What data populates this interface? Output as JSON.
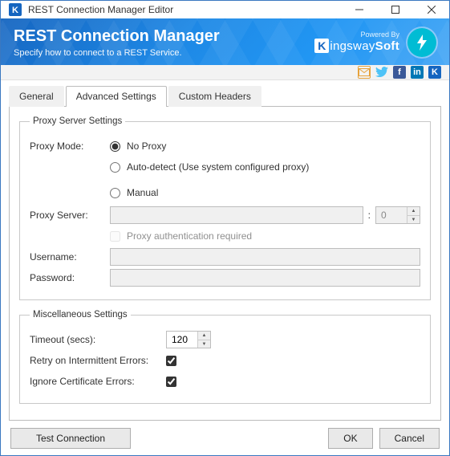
{
  "window": {
    "title": "REST Connection Manager Editor"
  },
  "banner": {
    "title": "REST Connection Manager",
    "subtitle": "Specify how to connect to a REST Service.",
    "powered_by": "Powered By",
    "brand_main": "ingsway",
    "brand_suffix": "Soft"
  },
  "tabs": {
    "general": "General",
    "advanced": "Advanced Settings",
    "custom": "Custom Headers"
  },
  "proxy": {
    "legend": "Proxy Server Settings",
    "mode_label": "Proxy Mode:",
    "opt_none": "No Proxy",
    "opt_auto": "Auto-detect (Use system configured proxy)",
    "opt_manual": "Manual",
    "server_label": "Proxy Server:",
    "server_value": "",
    "port_value": "0",
    "auth_label": "Proxy authentication required",
    "user_label": "Username:",
    "user_value": "",
    "pass_label": "Password:",
    "pass_value": ""
  },
  "misc": {
    "legend": "Miscellaneous Settings",
    "timeout_label": "Timeout (secs):",
    "timeout_value": "120",
    "retry_label": "Retry on Intermittent Errors:",
    "ignore_label": "Ignore Certificate Errors:"
  },
  "footer": {
    "test": "Test Connection",
    "ok": "OK",
    "cancel": "Cancel"
  }
}
